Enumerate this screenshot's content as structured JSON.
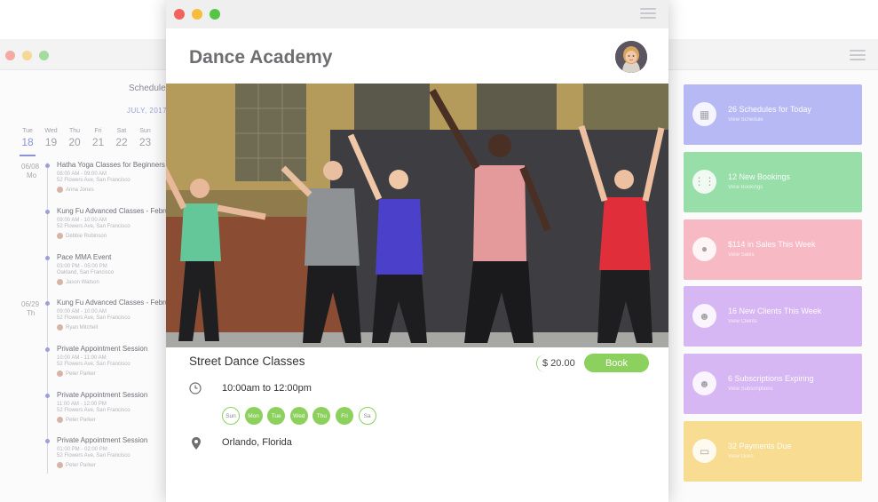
{
  "colors": {
    "accent_green": "#8cd05d",
    "schedule_accent": "#8b93d8",
    "card_blue": "#b7b9f4",
    "card_green": "#97dea9",
    "card_pink": "#f7b9c3",
    "card_purple": "#d6b6f3",
    "card_yellow": "#f7dc91"
  },
  "schedule": {
    "title": "Schedule",
    "month": "JULY, 2017",
    "days": [
      {
        "name": "Tue",
        "date": "18",
        "active": true
      },
      {
        "name": "Wed",
        "date": "19"
      },
      {
        "name": "Thu",
        "date": "20"
      },
      {
        "name": "Fri",
        "date": "21"
      },
      {
        "name": "Sat",
        "date": "22"
      },
      {
        "name": "Sun",
        "date": "23"
      }
    ],
    "groups": [
      {
        "date": "06/08",
        "weekday": "Mo"
      },
      {
        "date": "06/29",
        "weekday": "Th"
      }
    ],
    "events": [
      {
        "title": "Hatha Yoga Classes for Beginners",
        "time": "08:00 AM - 09:00 AM",
        "place": "52 Flowers Ave, San Francisco",
        "person": "Anna Jones"
      },
      {
        "title": "Kung Fu Advanced Classes - February",
        "time": "09:00 AM - 10:00 AM",
        "place": "52 Flowers Ave, San Francisco",
        "person": "Debbie Robinson"
      },
      {
        "title": "Pace MMA Event",
        "time": "03:00 PM - 05:00 PM",
        "place": "Oakland, San Francisco",
        "person": "Jason Watson"
      },
      {
        "title": "Kung Fu Advanced Classes - February",
        "time": "09:00 AM - 10:00 AM",
        "place": "52 Flowers Ave, San Francisco",
        "person": "Ryan Mitchell"
      },
      {
        "title": "Private Appointment Session",
        "time": "10:00 AM - 11:00 AM",
        "place": "52 Flowers Ave, San Francisco",
        "person": "Peter Parker"
      },
      {
        "title": "Private Appointment Session",
        "time": "11:00 AM - 12:00 PM",
        "place": "52 Flowers Ave, San Francisco",
        "person": "Peter Parker"
      },
      {
        "title": "Private Appointment Session",
        "time": "01:00 PM - 02:00 PM",
        "place": "52 Flowers Ave, San Francisco",
        "person": "Peter Parker"
      }
    ]
  },
  "dashboard": {
    "cards": [
      {
        "title": "26 Schedules for Today",
        "link": "View Schedule",
        "icon": "calendar-icon",
        "color": "#b7b9f4"
      },
      {
        "title": "12 New Bookings",
        "link": "View Bookings",
        "icon": "grid-icon",
        "color": "#97dea9"
      },
      {
        "title": "$114 in Sales This Week",
        "link": "View Sales",
        "icon": "money-bag-icon",
        "color": "#f7b9c3"
      },
      {
        "title": "16 New Clients This Week",
        "link": "View Clients",
        "icon": "users-icon",
        "color": "#d6b6f3"
      },
      {
        "title": "6 Subscriptions Expiring",
        "link": "View Subscriptions",
        "icon": "users-icon",
        "color": "#d6b6f3"
      },
      {
        "title": "32 Payments Due",
        "link": "View Dues",
        "icon": "cash-icon",
        "color": "#f7dc91"
      }
    ]
  },
  "app": {
    "title": "Dance Academy"
  },
  "class": {
    "name": "Street Dance Classes",
    "price": "$ 20.00",
    "book_label": "Book",
    "time": "10:00am to 12:00pm",
    "days": [
      {
        "label": "Sun",
        "on": false
      },
      {
        "label": "Mon",
        "on": true
      },
      {
        "label": "Tue",
        "on": true
      },
      {
        "label": "Wed",
        "on": true
      },
      {
        "label": "Thu",
        "on": true
      },
      {
        "label": "Fri",
        "on": true
      },
      {
        "label": "Sa",
        "on": false
      }
    ],
    "location": "Orlando, Florida"
  }
}
